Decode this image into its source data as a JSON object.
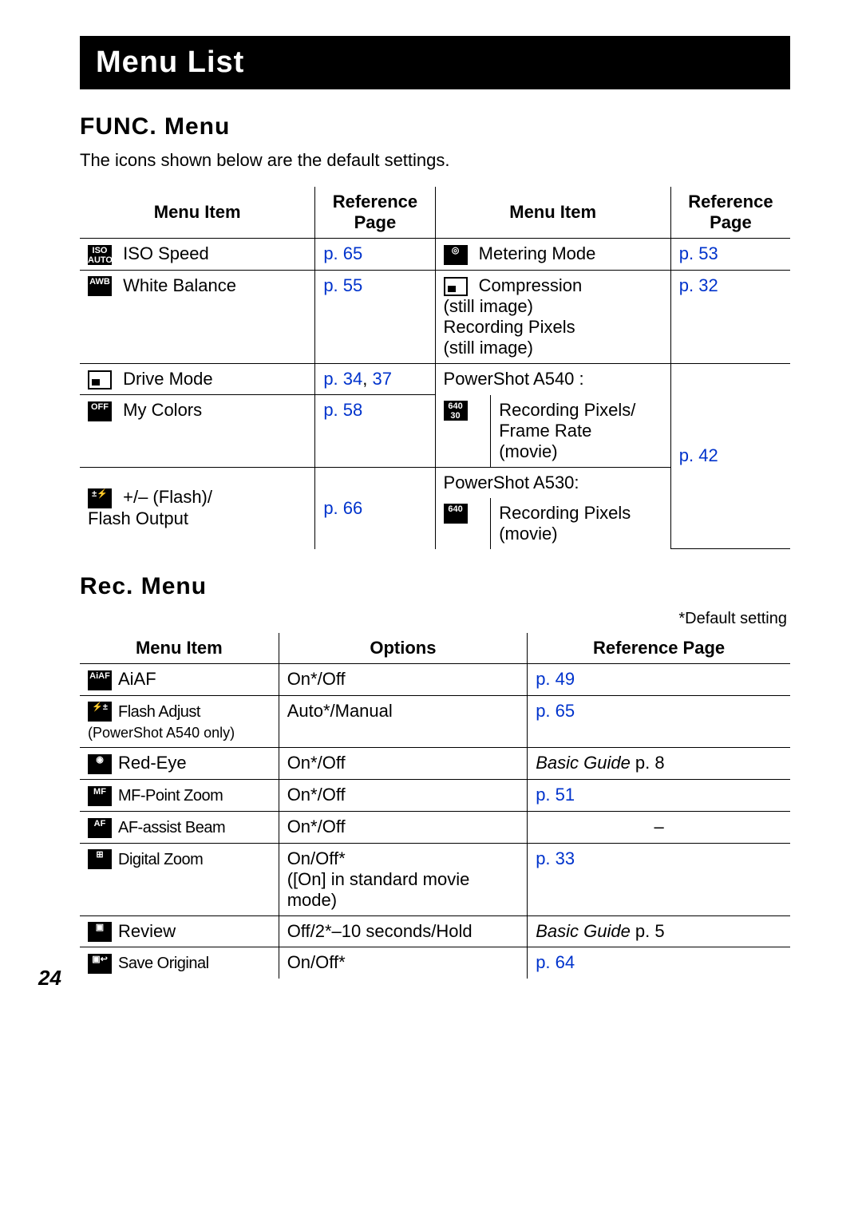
{
  "page_number": "24",
  "title": "Menu List",
  "func": {
    "heading": "FUNC. Menu",
    "desc": "The icons shown below are the default settings.",
    "col_labels": {
      "menu_item": "Menu Item",
      "ref_page": "Reference Page"
    },
    "left": [
      {
        "icon": "ISO AUTO",
        "name": "ISO Speed",
        "ref": "p. 65"
      },
      {
        "icon": "AWB",
        "name": "White Balance",
        "ref": "p. 55"
      },
      {
        "icon": "□",
        "name": "Drive Mode",
        "ref_a": "p. 34",
        "ref_b": "37"
      },
      {
        "icon": "OFF",
        "name": "My Colors",
        "ref": "p. 58"
      },
      {
        "icon": "±⚡",
        "name": "+/– (Flash)/\nFlash Output",
        "ref": "p. 66"
      }
    ],
    "right": [
      {
        "icon": "◎",
        "name": "Metering Mode",
        "ref": "p. 53"
      },
      {
        "icon": "◣L",
        "name": "Compression (still image)\nRecording Pixels (still image)",
        "ref": "p. 32"
      },
      {
        "heading": "PowerShot A540 :",
        "icon": "640 30",
        "name": "Recording Pixels/ Frame Rate (movie)",
        "heading2": "PowerShot A530:",
        "icon2": "640",
        "name2": "Recording Pixels (movie)",
        "ref": "p. 42"
      }
    ]
  },
  "rec": {
    "heading": "Rec. Menu",
    "default_note": "*Default setting",
    "col_labels": {
      "menu_item": "Menu Item",
      "options": "Options",
      "ref_page": "Reference Page"
    },
    "rows": [
      {
        "icon": "AiAF",
        "name": "AiAF",
        "options": "On*/Off",
        "ref": "p. 49",
        "ref_link": true
      },
      {
        "icon": "⚡±",
        "name": "Flash Adjust",
        "note": "(PowerShot A540 only)",
        "options": "Auto*/Manual",
        "ref": "p. 65",
        "ref_link": true
      },
      {
        "icon": "◉",
        "name": "Red-Eye",
        "options": "On*/Off",
        "ref_prefix": "Basic Guide ",
        "ref": "p. 8",
        "ref_link": false
      },
      {
        "icon": "MF⤢",
        "name": "MF-Point Zoom",
        "options": "On*/Off",
        "ref": "p. 51",
        "ref_link": true
      },
      {
        "icon": "AF··",
        "name": "AF-assist Beam",
        "options": "On*/Off",
        "ref": "–",
        "ref_link": false
      },
      {
        "icon": "⊞",
        "name": "Digital Zoom",
        "options": "On/Off*\n([On] in standard movie mode)",
        "ref": "p. 33",
        "ref_link": true
      },
      {
        "icon": "▣",
        "name": "Review",
        "options": "Off/2*–10 seconds/Hold",
        "ref_prefix": "Basic Guide ",
        "ref": "p. 5",
        "ref_link": false
      },
      {
        "icon": "▣↩",
        "name": "Save Original",
        "options": "On/Off*",
        "ref": "p. 64",
        "ref_link": true
      }
    ]
  }
}
